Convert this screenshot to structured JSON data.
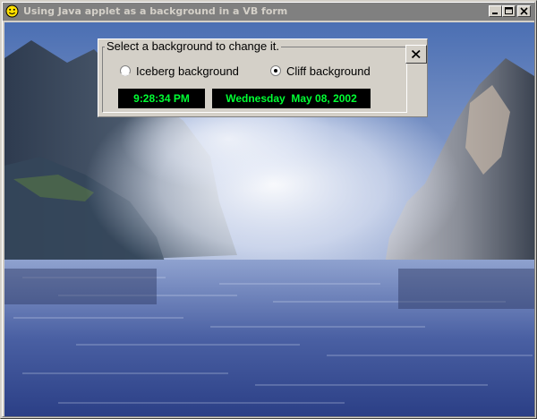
{
  "window": {
    "title": "Using Java applet as a background in a VB form",
    "icon": "smiley-icon",
    "controls": [
      "minimize-icon",
      "maximize-icon",
      "close-icon"
    ]
  },
  "panel": {
    "caption": "Select a background to change it.",
    "options": [
      {
        "label": "Iceberg background",
        "selected": false
      },
      {
        "label": "Cliff background",
        "selected": true
      }
    ],
    "time": "9:28:34 PM",
    "date": "Wednesday  May 08, 2002",
    "close_glyph": "close-icon"
  },
  "colors": {
    "lcd_text": "#00ff33",
    "lcd_background": "#000000",
    "titlebar": "#808080",
    "chrome": "#d4d0c8"
  }
}
